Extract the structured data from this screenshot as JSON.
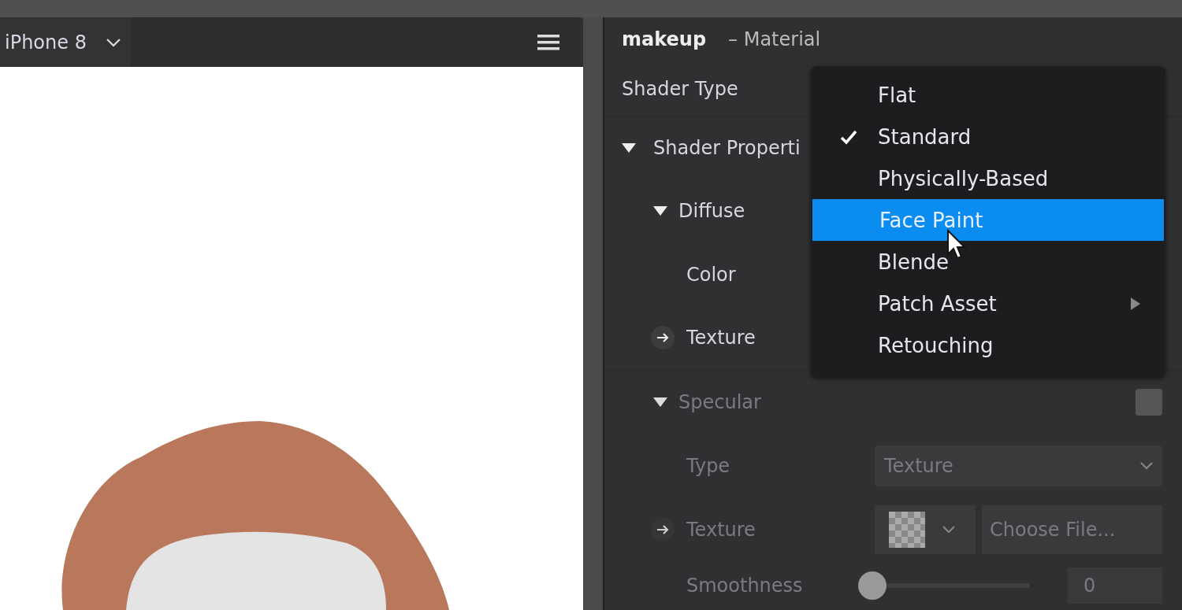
{
  "viewport": {
    "device": "iPhone 8"
  },
  "inspector": {
    "name": "makeup",
    "type_label": "– Material",
    "shader_type": {
      "label": "Shader Type"
    },
    "shader_properties": {
      "label": "Shader Properti",
      "expanded": true
    },
    "diffuse": {
      "label": "Diffuse",
      "expanded": true,
      "color_label": "Color",
      "texture_label": "Texture"
    },
    "specular": {
      "label": "Specular",
      "expanded": true,
      "disabled": true,
      "checked": false,
      "type_label": "Type",
      "type_value": "Texture",
      "texture_label": "Texture",
      "file_placeholder": "Choose File...",
      "smoothness_label": "Smoothness",
      "smoothness": {
        "level": 0
      },
      "smoothness_value": "0"
    }
  },
  "dropdown": {
    "items": [
      {
        "label": "Flat",
        "checked": false,
        "selected": false,
        "submenu": false
      },
      {
        "label": "Standard",
        "checked": true,
        "selected": false,
        "submenu": false
      },
      {
        "label": "Physically-Based",
        "checked": false,
        "selected": false,
        "submenu": false
      },
      {
        "label": "Face Paint",
        "checked": false,
        "selected": true,
        "submenu": false
      },
      {
        "label": "Blende",
        "checked": false,
        "selected": false,
        "submenu": false
      },
      {
        "label": "Patch Asset",
        "checked": false,
        "selected": false,
        "submenu": true
      },
      {
        "label": "Retouching",
        "checked": false,
        "selected": false,
        "submenu": false
      }
    ]
  }
}
